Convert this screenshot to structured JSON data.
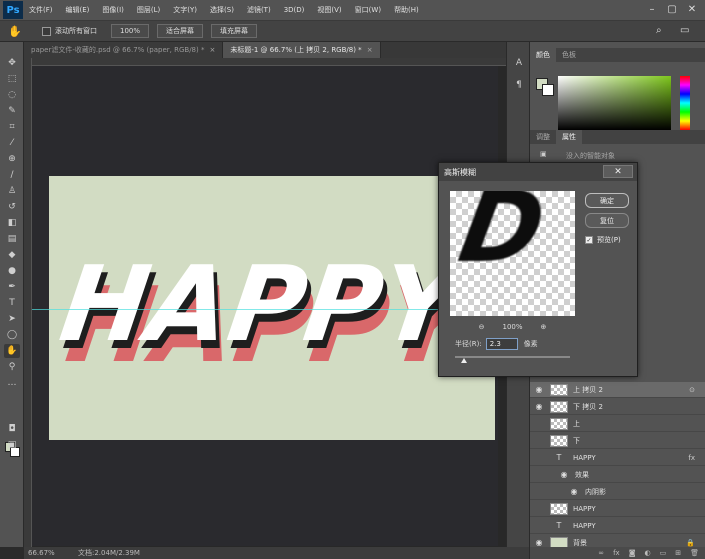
{
  "app": {
    "logo": "Ps"
  },
  "menu": [
    "文件(F)",
    "编辑(E)",
    "图像(I)",
    "图层(L)",
    "文字(Y)",
    "选择(S)",
    "滤镜(T)",
    "3D(D)",
    "视图(V)",
    "窗口(W)",
    "帮助(H)"
  ],
  "options": {
    "scroll_all_label": "滚动所有窗口",
    "zoom_btn": "100%",
    "fit_screen_btn": "适合屏幕",
    "fill_screen_btn": "填充屏幕"
  },
  "tabs": [
    {
      "label": "paper滤文件-收藏的.psd @ 66.7% (paper, RGB/8) *",
      "active": false
    },
    {
      "label": "未标题-1 @ 66.7% (上 拷贝 2, RGB/8) *",
      "active": true
    }
  ],
  "canvas": {
    "text": "HAPPY",
    "bg_color": "#d2dcc3",
    "shadow_color": "#d9686a"
  },
  "status": {
    "zoom": "66.67%",
    "doc": "文档:2.04M/2.39M"
  },
  "color_panel": {
    "tabs": [
      "颜色",
      "色板"
    ],
    "fg": "#d2dcc3",
    "bg": "#ffffff"
  },
  "props_panel": {
    "tabs": [
      "调整",
      "属性"
    ],
    "hint": "没入的智能对象"
  },
  "dialog": {
    "title": "高斯模糊",
    "close": "✕",
    "ok": "确定",
    "reset": "复位",
    "preview_label": "预览(P)",
    "zoom": "100%",
    "radius_label": "半径(R):",
    "radius_value": "2.3",
    "radius_unit": "像素",
    "preview_glyph": "D",
    "slider_fraction": 0.08
  },
  "layers": [
    {
      "name": "上 拷贝 2",
      "type": "img",
      "visible": true,
      "selected": true
    },
    {
      "name": "下 拷贝 2",
      "type": "img",
      "visible": true,
      "selected": false
    },
    {
      "name": "上",
      "type": "img",
      "visible": false,
      "selected": false
    },
    {
      "name": "下",
      "type": "img",
      "visible": false,
      "selected": false
    },
    {
      "name": "HAPPY",
      "type": "text",
      "visible": false,
      "selected": false,
      "fx": "fx"
    },
    {
      "name": "效果",
      "type": "effect",
      "visible": true,
      "selected": false
    },
    {
      "name": "内阴影",
      "type": "effect2",
      "visible": true,
      "selected": false
    },
    {
      "name": "HAPPY",
      "type": "img",
      "visible": false,
      "selected": false
    },
    {
      "name": "HAPPY",
      "type": "text",
      "visible": false,
      "selected": false
    },
    {
      "name": "背景",
      "type": "bg",
      "visible": true,
      "selected": false,
      "lock": "🔒"
    }
  ]
}
